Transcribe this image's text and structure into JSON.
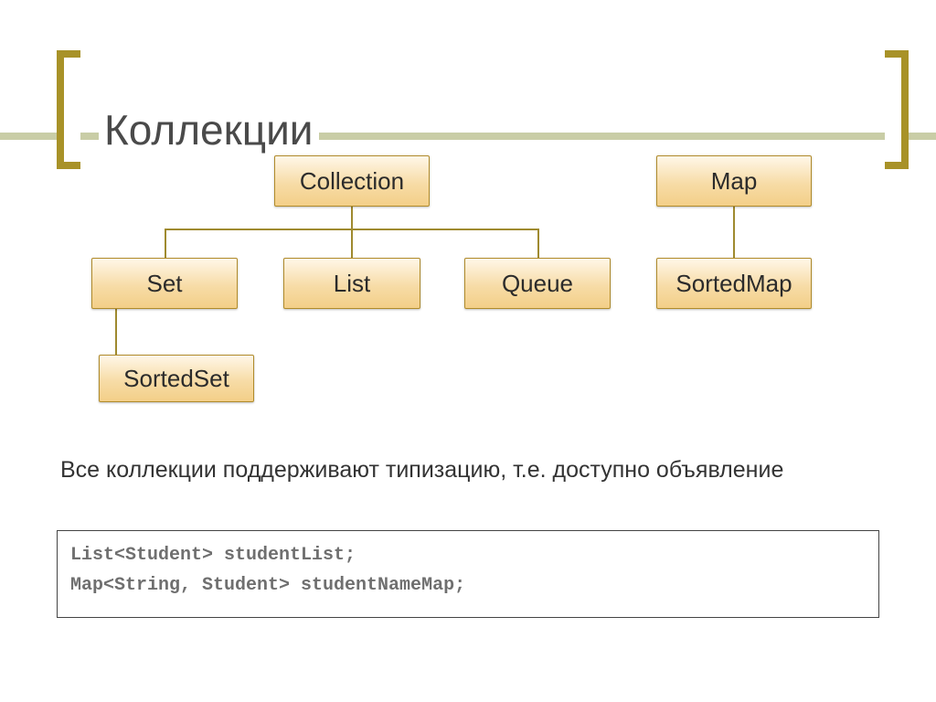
{
  "title": "Коллекции",
  "nodes": {
    "collection": "Collection",
    "map": "Map",
    "set": "Set",
    "list": "List",
    "queue": "Queue",
    "sortedmap": "SortedMap",
    "sortedset": "SortedSet"
  },
  "caption": "Все коллекции поддерживают типизацию, т.е. доступно объявление",
  "code": {
    "line1": "List<Student> studentList;",
    "line2": "Map<String, Student> studentNameMap;"
  },
  "colors": {
    "accent": "#a89228",
    "rule": "#c9cda6",
    "node_border": "#b08b2b",
    "node_top": "#fff7e8",
    "node_bottom": "#f3cf88"
  }
}
